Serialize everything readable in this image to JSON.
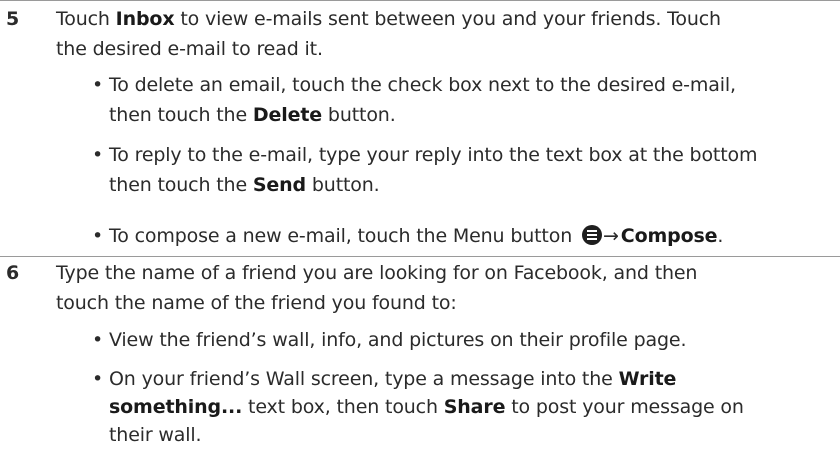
{
  "step5": {
    "number": "5",
    "line1_a": "Touch ",
    "line1_bold": "Inbox",
    "line1_b": " to view e-mails sent between you and your friends. Touch",
    "line2": "the desired e-mail to read it.",
    "bullets": [
      {
        "dot": "•",
        "line1": "To delete an email, touch the check box next to the desired e-mail,",
        "line2_a": "then touch the ",
        "line2_bold": "Delete",
        "line2_b": " button."
      },
      {
        "dot": "•",
        "line1": "To reply to the e-mail, type your reply into the text box at the bottom",
        "line2_a": "then touch the ",
        "line2_bold": "Send",
        "line2_b": " button."
      },
      {
        "dot": "•",
        "line1_a": "To compose a new e-mail, touch the Menu button ",
        "icon": "menu-icon",
        "arrow": "→",
        "line1_bold": "Compose",
        "line1_end": "."
      }
    ]
  },
  "step6": {
    "number": "6",
    "line1": "Type the name of a friend you are looking for on Facebook, and then",
    "line2": "touch the name of the friend you found to:",
    "bullets": [
      {
        "dot": "•",
        "line1": "View the friend’s wall, info, and pictures on their profile page."
      },
      {
        "dot": "•",
        "line1_a": "On your friend’s Wall screen, type a message into the ",
        "line1_bold": "Write",
        "line2_bold": "something...",
        "line2_a": " text box, then touch ",
        "line2_bold2": "Share",
        "line2_b": " to post your message on",
        "line3": "their wall."
      }
    ]
  }
}
